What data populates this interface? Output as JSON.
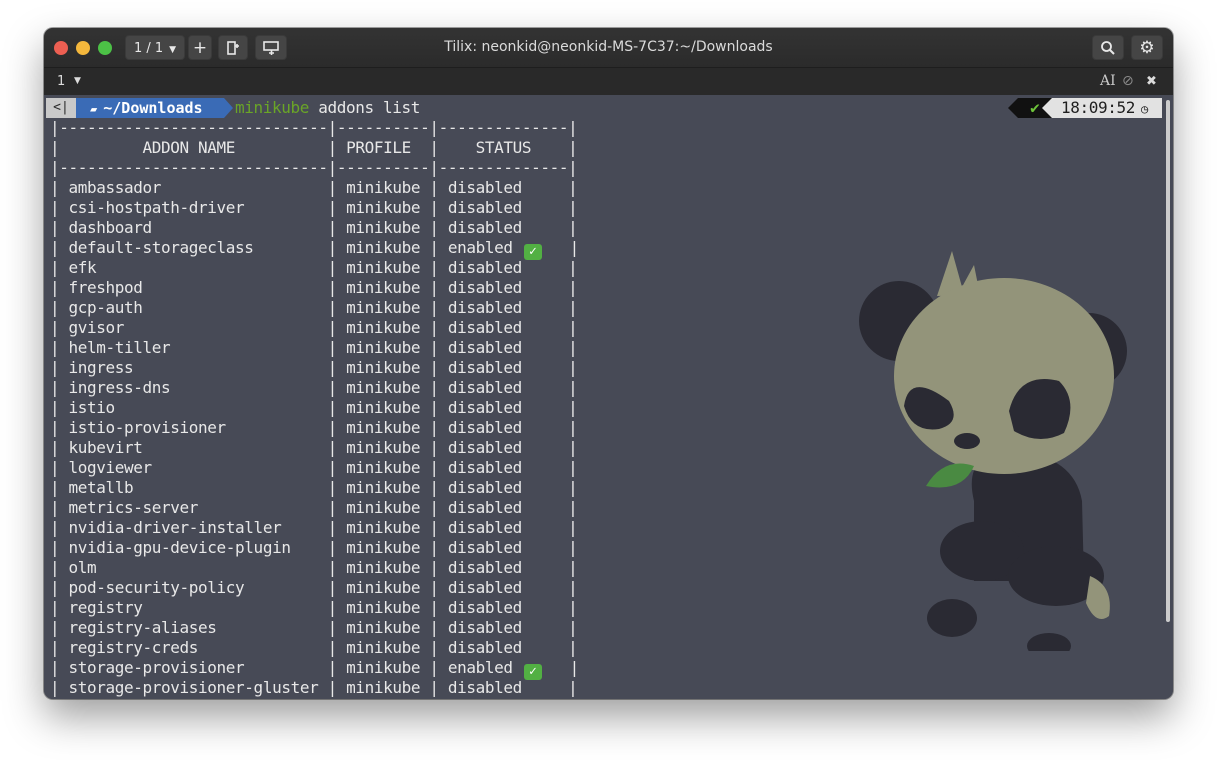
{
  "window": {
    "title": "Tilix: neonkid@neonkid-MS-7C37:~/Downloads"
  },
  "titlebar": {
    "session": "1 / 1",
    "plus": "+"
  },
  "tabbar": {
    "tab_number": "1"
  },
  "prompt": {
    "directory": "~/Downloads",
    "command_bin": "minikube",
    "command_args": " addons list",
    "status_mark": "✔",
    "time": "18:09:52"
  },
  "table": {
    "sep_line": "|-----------------------------|----------|--------------|",
    "header_line": "|         ADDON NAME          | PROFILE  |    STATUS    |",
    "rows": [
      {
        "name": "ambassador",
        "profile": "minikube",
        "status": "disabled"
      },
      {
        "name": "csi-hostpath-driver",
        "profile": "minikube",
        "status": "disabled"
      },
      {
        "name": "dashboard",
        "profile": "minikube",
        "status": "disabled"
      },
      {
        "name": "default-storageclass",
        "profile": "minikube",
        "status": "enabled",
        "emoji": "✓"
      },
      {
        "name": "efk",
        "profile": "minikube",
        "status": "disabled"
      },
      {
        "name": "freshpod",
        "profile": "minikube",
        "status": "disabled"
      },
      {
        "name": "gcp-auth",
        "profile": "minikube",
        "status": "disabled"
      },
      {
        "name": "gvisor",
        "profile": "minikube",
        "status": "disabled"
      },
      {
        "name": "helm-tiller",
        "profile": "minikube",
        "status": "disabled"
      },
      {
        "name": "ingress",
        "profile": "minikube",
        "status": "disabled"
      },
      {
        "name": "ingress-dns",
        "profile": "minikube",
        "status": "disabled"
      },
      {
        "name": "istio",
        "profile": "minikube",
        "status": "disabled"
      },
      {
        "name": "istio-provisioner",
        "profile": "minikube",
        "status": "disabled"
      },
      {
        "name": "kubevirt",
        "profile": "minikube",
        "status": "disabled"
      },
      {
        "name": "logviewer",
        "profile": "minikube",
        "status": "disabled"
      },
      {
        "name": "metallb",
        "profile": "minikube",
        "status": "disabled"
      },
      {
        "name": "metrics-server",
        "profile": "minikube",
        "status": "disabled"
      },
      {
        "name": "nvidia-driver-installer",
        "profile": "minikube",
        "status": "disabled"
      },
      {
        "name": "nvidia-gpu-device-plugin",
        "profile": "minikube",
        "status": "disabled"
      },
      {
        "name": "olm",
        "profile": "minikube",
        "status": "disabled"
      },
      {
        "name": "pod-security-policy",
        "profile": "minikube",
        "status": "disabled"
      },
      {
        "name": "registry",
        "profile": "minikube",
        "status": "disabled"
      },
      {
        "name": "registry-aliases",
        "profile": "minikube",
        "status": "disabled"
      },
      {
        "name": "registry-creds",
        "profile": "minikube",
        "status": "disabled"
      },
      {
        "name": "storage-provisioner",
        "profile": "minikube",
        "status": "enabled",
        "emoji": "✓"
      },
      {
        "name": "storage-provisioner-gluster",
        "profile": "minikube",
        "status": "disabled"
      }
    ]
  },
  "colors": {
    "terminal_bg": "#474a56",
    "prompt_dir_bg": "#3a6bb6",
    "command_bin": "#6aa527",
    "panda_body": "#93947a",
    "panda_dark": "#2a2a33",
    "leaf": "#4a8a42"
  }
}
